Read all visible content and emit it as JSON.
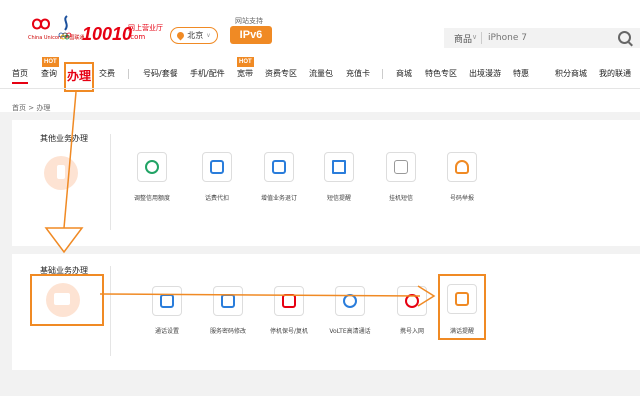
{
  "header": {
    "logo_caption": "China Unicom 中国联通",
    "brand_number": "10010",
    "brand_sub": "网上营业厅",
    "brand_domain": ".com",
    "city": "北京",
    "city_caret": "∨",
    "ipv6_note": "网站支持",
    "ipv6_label": "IPv6",
    "search_category": "商品",
    "search_caret": "∨",
    "search_placeholder": "iPhone 7"
  },
  "nav": {
    "items": [
      "首页",
      "查询",
      "办理",
      "交费",
      "号码/套餐",
      "手机/配件",
      "宽带",
      "资费专区",
      "流量包",
      "充值卡",
      "商城",
      "特色专区",
      "出境漫游",
      "特惠",
      "积分商城",
      "我的联通"
    ],
    "hot_label": "HOT"
  },
  "breadcrumb": "首页 > 办理",
  "sections": {
    "other": {
      "title": "其他业务办理",
      "items": [
        "调整信用额度",
        "话费代扣",
        "增值业务退订",
        "短信提醒",
        "挂机短信",
        "号码举报"
      ]
    },
    "basic": {
      "title": "基础业务办理",
      "items": [
        "通话设置",
        "服务密码修改",
        "停机保号/复机",
        "VoLTE高清通话",
        "携号入网",
        "满话提醒"
      ]
    }
  },
  "colors": {
    "brand_red": "#e60012",
    "accent_orange": "#f08a24",
    "page_bg": "#f2f2f2"
  }
}
